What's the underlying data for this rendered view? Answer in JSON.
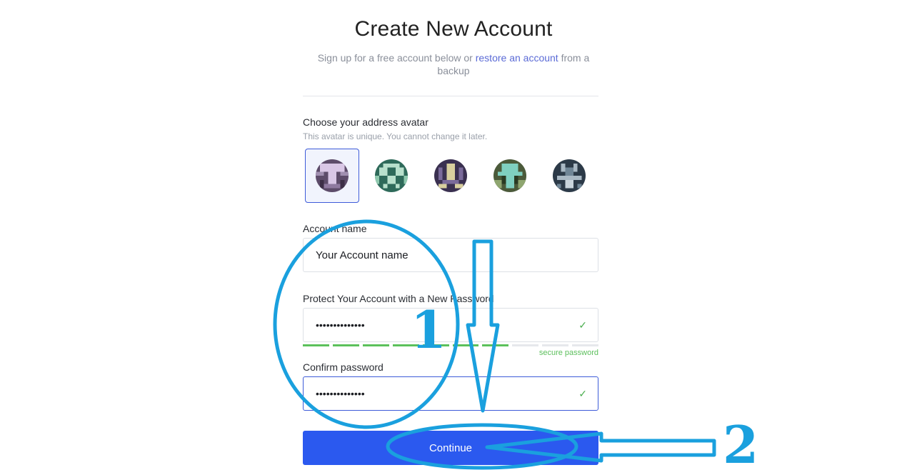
{
  "header": {
    "title": "Create New Account",
    "subtitle_before": "Sign up for a free account below or ",
    "subtitle_link": "restore an account",
    "subtitle_after": " from a backup"
  },
  "avatar_section": {
    "label": "Choose your address avatar",
    "hint": "This avatar is unique. You cannot change it later.",
    "selected_index": 0
  },
  "account_name": {
    "label": "Account name",
    "value": "Your Account name"
  },
  "password": {
    "label": "Protect Your Account with a New Password",
    "value": "••••••••••••••",
    "strength_text": "secure password",
    "strength_level": 0.7
  },
  "confirm_password": {
    "label": "Confirm password",
    "value": "••••••••••••••"
  },
  "continue_button": {
    "label": "Continue"
  },
  "annotations": {
    "step1": "1",
    "step2": "2"
  },
  "colors": {
    "accent": "#2b59ef",
    "link": "#5b6bd6",
    "success": "#5cc15c",
    "annotation": "#1aa0de"
  }
}
